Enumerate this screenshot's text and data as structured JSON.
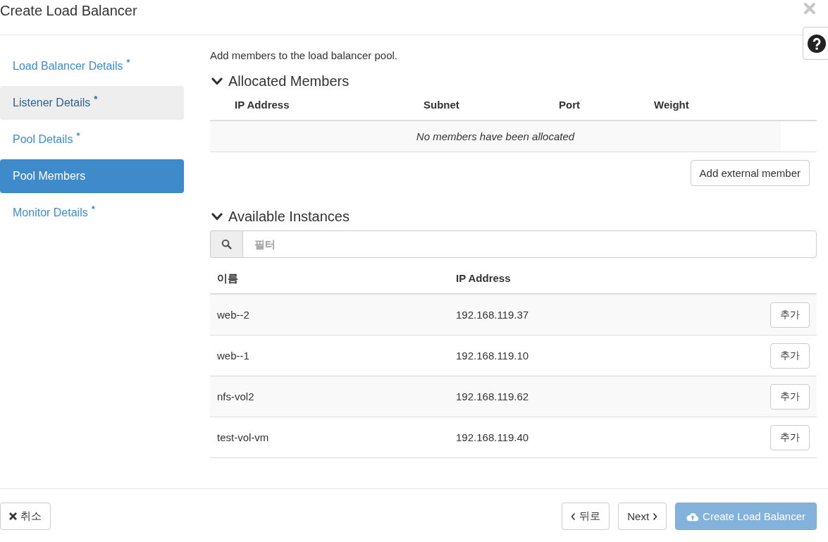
{
  "dialog": {
    "title": "Create Load Balancer"
  },
  "steps": [
    {
      "label": "Load Balancer Details",
      "required_mark": "*",
      "selected": false,
      "hovered": false
    },
    {
      "label": "Listener Details",
      "required_mark": "*",
      "selected": false,
      "hovered": true
    },
    {
      "label": "Pool Details",
      "required_mark": "*",
      "selected": false,
      "hovered": false
    },
    {
      "label": "Pool Members",
      "selected": true,
      "hovered": false
    },
    {
      "label": "Monitor Details",
      "required_mark": "*",
      "selected": false,
      "hovered": false
    }
  ],
  "intro": "Add members to the load balancer pool.",
  "allocated_members": {
    "title": "Allocated Members",
    "expanded": true,
    "columns": [
      "IP Address",
      "Subnet",
      "Port",
      "Weight"
    ],
    "empty_message": "No members have been allocated",
    "add_button": "Add external member"
  },
  "available_instances": {
    "title": "Available Instances",
    "expanded": true,
    "filter": {
      "placeholder": "필터"
    },
    "columns": [
      "이름",
      "IP Address"
    ],
    "rows": [
      {
        "name": "web--2",
        "ip": "192.168.119.37",
        "action": "추가"
      },
      {
        "name": "web--1",
        "ip": "192.168.119.10",
        "action": "추가"
      },
      {
        "name": "nfs-vol2",
        "ip": "192.168.119.62",
        "action": "추가"
      },
      {
        "name": "test-vol-vm",
        "ip": "192.168.119.40",
        "action": "추가"
      }
    ]
  },
  "footer": {
    "cancel": "취소",
    "back": "뒤로",
    "next": "Next",
    "create": {
      "label": "Create Load Balancer",
      "disabled": true
    }
  }
}
